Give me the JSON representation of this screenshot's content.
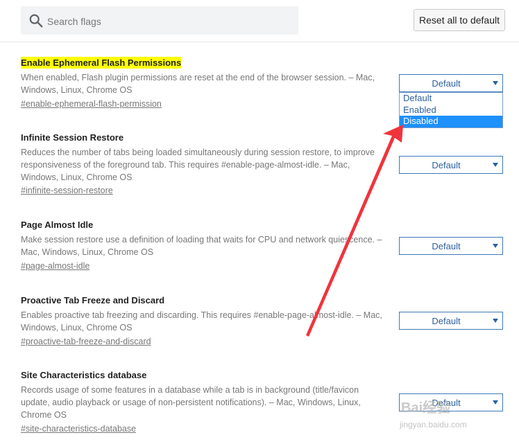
{
  "search": {
    "placeholder": "Search flags",
    "icon": "search-icon"
  },
  "reset_button": {
    "label": "Reset all to default"
  },
  "experiments": [
    {
      "title": "Enable Ephemeral Flash Permissions",
      "description": "When enabled, Flash plugin permissions are reset at the end of the browser session. – Mac, Windows, Linux, Chrome OS",
      "link": "#enable-ephemeral-flash-permission",
      "select_value": "Default",
      "highlighted": true
    },
    {
      "title": "Infinite Session Restore",
      "description": "Reduces the number of tabs being loaded simultaneously during session restore, to improve responsiveness of the foreground tab. This requires #enable-page-almost-idle. – Mac, Windows, Linux, Chrome OS",
      "link": "#infinite-session-restore",
      "select_value": "Default"
    },
    {
      "title": "Page Almost Idle",
      "description": "Make session restore use a definition of loading that waits for CPU and network quiescence. – Mac, Windows, Linux, Chrome OS",
      "link": "#page-almost-idle",
      "select_value": "Default"
    },
    {
      "title": "Proactive Tab Freeze and Discard",
      "description": "Enables proactive tab freezing and discarding. This requires #enable-page-almost-idle. – Mac, Windows, Linux, Chrome OS",
      "link": "#proactive-tab-freeze-and-discard",
      "select_value": "Default"
    },
    {
      "title": "Site Characteristics database",
      "description": "Records usage of some features in a database while a tab is in background (title/favicon update, audio playback or usage of non-persistent notifications). – Mac, Windows, Linux, Chrome OS",
      "link": "#site-characteristics-database",
      "select_value": "Default"
    }
  ],
  "dropdown": {
    "options": [
      "Default",
      "Enabled",
      "Disabled"
    ],
    "highlighted": "Disabled"
  },
  "annotation": {
    "color": "#f0343c"
  },
  "watermark": {
    "text": "Bai经验",
    "sub": "jingyan.baidu.com"
  },
  "colors": {
    "highlight": "#ffff00",
    "link": "#2b5f9e",
    "selected_option": "#1e90ff"
  }
}
